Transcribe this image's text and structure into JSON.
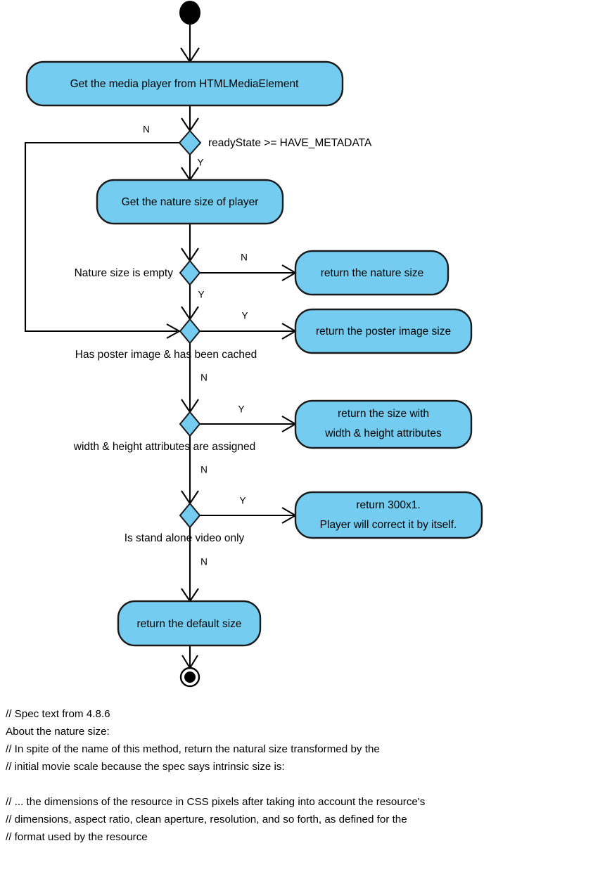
{
  "diagram": {
    "type": "uml-activity-diagram",
    "title_text": null,
    "colors": {
      "node_fill": "#74cdf0",
      "node_stroke": "#1a1a1a",
      "edge": "#000000",
      "background": "#ffffff"
    },
    "nodes": {
      "start": {
        "kind": "initial-node",
        "label": ""
      },
      "get_media_player": {
        "kind": "activity",
        "label": "Get the media player from HTMLMediaElement"
      },
      "ready_state": {
        "kind": "decision",
        "label": "readyState >= HAVE_METADATA"
      },
      "get_nature_size": {
        "kind": "activity",
        "label": "Get the nature size of player"
      },
      "nature_empty": {
        "kind": "decision",
        "label": "Nature size is empty"
      },
      "return_nature_size": {
        "kind": "activity",
        "label": "return the nature size"
      },
      "has_poster": {
        "kind": "decision",
        "label": "Has poster image & has been cached"
      },
      "return_poster_size": {
        "kind": "activity",
        "label": "return the poster image size"
      },
      "wh_assigned": {
        "kind": "decision",
        "label": "width & height attributes are assigned"
      },
      "return_wh_size": {
        "kind": "activity",
        "label_line1": "return the size with",
        "label_line2": "width & height attributes"
      },
      "stand_alone": {
        "kind": "decision",
        "label": "Is stand alone video only"
      },
      "return_300x1": {
        "kind": "activity",
        "label_line1": "return 300x1.",
        "label_line2": "Player will correct it by itself."
      },
      "return_default_size": {
        "kind": "activity",
        "label": "return the default size"
      },
      "end": {
        "kind": "final-node",
        "label": ""
      }
    },
    "branch_labels": {
      "ready_state_no": "N",
      "ready_state_yes": "Y",
      "nature_empty_no": "N",
      "nature_empty_yes": "Y",
      "has_poster_yes": "Y",
      "has_poster_no": "N",
      "wh_assigned_yes": "Y",
      "wh_assigned_no": "N",
      "stand_alone_yes": "Y",
      "stand_alone_no": "N"
    }
  },
  "notes": {
    "lines": [
      "// Spec text from 4.8.6",
      "About the nature size:",
      "// In spite of the name of this method, return the natural size transformed by the",
      "// initial movie scale because the spec says intrinsic size is:",
      "",
      "// ... the dimensions of the resource in CSS pixels after taking into account the resource's",
      "// dimensions, aspect ratio, clean aperture, resolution, and so forth, as defined for the",
      "// format used by the resource"
    ],
    "line_0": "// Spec text from 4.8.6",
    "line_1": "About the nature size:",
    "line_2": "// In spite of the name of this method, return the natural size transformed by the",
    "line_3": "// initial movie scale because the spec says intrinsic size is:",
    "line_4": "",
    "line_5": "// ... the dimensions of the resource in CSS pixels after taking into account the resource's",
    "line_6": "// dimensions, aspect ratio, clean aperture, resolution, and so forth, as defined for the",
    "line_7": "// format used by the resource"
  }
}
